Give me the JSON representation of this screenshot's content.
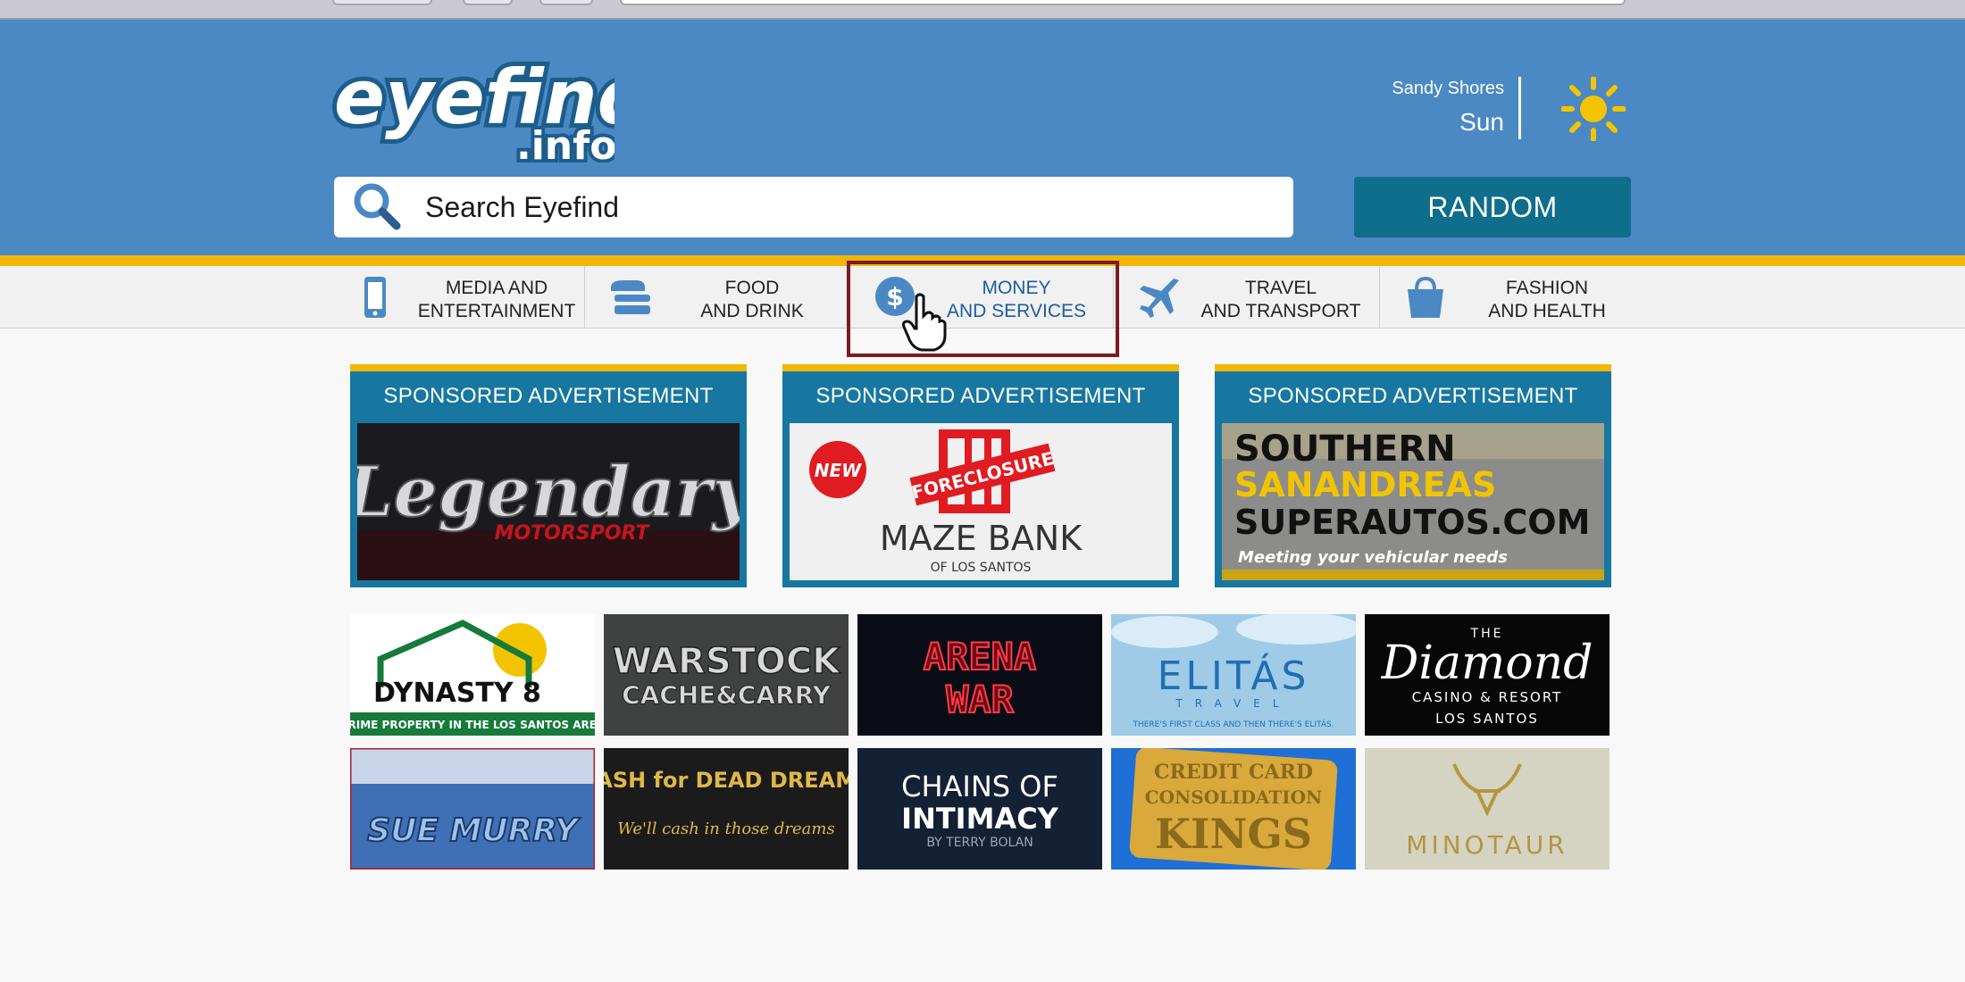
{
  "header": {
    "logo_text_1": "eyefind",
    "logo_text_2": ".info",
    "weather": {
      "city": "Sandy Shores",
      "condition": "Sun"
    },
    "search_placeholder": "Search Eyefind",
    "random_label": "RANDOM"
  },
  "nav": [
    {
      "line1": "MEDIA AND",
      "line2": "ENTERTAINMENT",
      "icon": "phone-icon"
    },
    {
      "line1": "FOOD",
      "line2": "AND DRINK",
      "icon": "burger-icon"
    },
    {
      "line1": "MONEY",
      "line2": "AND SERVICES",
      "icon": "dollar-icon"
    },
    {
      "line1": "TRAVEL",
      "line2": "AND TRANSPORT",
      "icon": "plane-icon"
    },
    {
      "line1": "FASHION",
      "line2": "AND HEALTH",
      "icon": "shopping-bag-icon"
    }
  ],
  "ads": [
    {
      "title": "SPONSORED ADVERTISEMENT",
      "brand": "Legendary",
      "sub": "MOTORSPORT"
    },
    {
      "title": "SPONSORED ADVERTISEMENT",
      "badge": "NEW",
      "stamp": "FORECLOSURE",
      "brand": "MAZE BANK",
      "sub": "OF LOS SANTOS"
    },
    {
      "title": "SPONSORED ADVERTISEMENT",
      "line1": "SOUTHERN",
      "line2": "SANANDREAS",
      "line3": "SUPERAUTOS.COM",
      "tagline": "Meeting your vehicular needs"
    }
  ],
  "tiles": [
    {
      "title": "DYNASTY 8",
      "sub": "PRIME PROPERTY IN THE LOS SANTOS AREA"
    },
    {
      "title": "WARSTOCK",
      "sub": "CACHE&CARRY"
    },
    {
      "title": "ARENA",
      "sub": "WAR"
    },
    {
      "title": "ELITÁS",
      "sub": "TRAVEL",
      "tag": "THERE'S FIRST CLASS AND THEN THERE'S ELITÁS."
    },
    {
      "title": "THE",
      "sub": "Diamond",
      "line3": "CASINO & RESORT",
      "line4": "LOS SANTOS"
    },
    {
      "title": "SUE MURRY"
    },
    {
      "title": "CASH for DEAD DREAMS",
      "sub": "We'll cash in those dreams"
    },
    {
      "title": "CHAINS OF",
      "sub": "INTIMACY",
      "line3": "BY TERRY BOLAN"
    },
    {
      "title": "CREDIT CARD",
      "sub": "CONSOLIDATION",
      "line3": "KINGS"
    },
    {
      "title": "MINOTAUR"
    }
  ],
  "colors": {
    "header": "#4a89c4",
    "accent_yellow": "#f2b705",
    "button": "#0e6e8c",
    "ad_frame": "#1777a0",
    "highlight": "#7a1a24"
  }
}
